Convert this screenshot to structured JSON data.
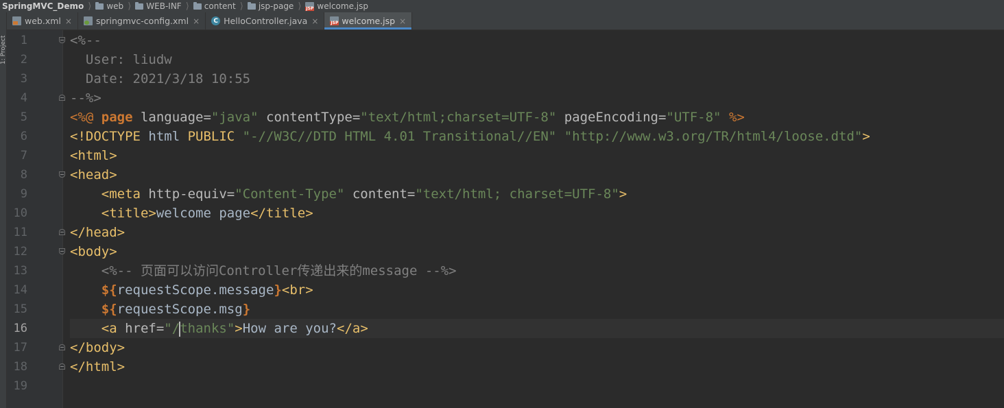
{
  "breadcrumb": [
    {
      "label": "SpringMVC_Demo",
      "icon": "none"
    },
    {
      "label": "web",
      "icon": "folder-icon"
    },
    {
      "label": "WEB-INF",
      "icon": "folder-icon"
    },
    {
      "label": "content",
      "icon": "folder-icon"
    },
    {
      "label": "jsp-page",
      "icon": "folder-icon"
    },
    {
      "label": "welcome.jsp",
      "icon": "jsp-file-icon"
    }
  ],
  "sidebar": {
    "label": "1: Project"
  },
  "tabs": [
    {
      "label": "web.xml",
      "icon": "xml-file-icon",
      "active": false
    },
    {
      "label": "springmvc-config.xml",
      "icon": "spring-xml-file-icon",
      "active": false
    },
    {
      "label": "HelloController.java",
      "icon": "java-class-icon",
      "active": false
    },
    {
      "label": "welcome.jsp",
      "icon": "jsp-file-icon",
      "active": true
    }
  ],
  "tab_close_glyph": "×",
  "editor": {
    "current_line": 16,
    "lines": [
      {
        "n": "1",
        "fold": "start",
        "tokens": [
          [
            "comment",
            "<%--"
          ]
        ]
      },
      {
        "n": "2",
        "tokens": [
          [
            "comment",
            "  User: liudw"
          ]
        ]
      },
      {
        "n": "3",
        "tokens": [
          [
            "comment",
            "  Date: 2021/3/18 10:55"
          ]
        ]
      },
      {
        "n": "4",
        "fold": "end",
        "tokens": [
          [
            "comment",
            "--%>"
          ]
        ]
      },
      {
        "n": "5",
        "tokens": [
          [
            "directive",
            "<%@ "
          ],
          [
            "keyword",
            "page"
          ],
          [
            "attr",
            " language="
          ],
          [
            "value",
            "\"java\""
          ],
          [
            "attr",
            " contentType="
          ],
          [
            "value",
            "\"text/html;charset=UTF-8\""
          ],
          [
            "attr",
            " pageEncoding="
          ],
          [
            "value",
            "\"UTF-8\""
          ],
          [
            "directive",
            " %>"
          ]
        ]
      },
      {
        "n": "6",
        "tokens": [
          [
            "tag",
            "<!DOCTYPE "
          ],
          [
            "plain",
            "html "
          ],
          [
            "tag",
            "PUBLIC "
          ],
          [
            "value",
            "\"-//W3C//DTD HTML 4.01 Transitional//EN\""
          ],
          [
            "plain",
            " "
          ],
          [
            "value",
            "\"http://www.w3.org/TR/html4/loose.dtd\""
          ],
          [
            "tag",
            ">"
          ]
        ]
      },
      {
        "n": "7",
        "tokens": [
          [
            "tag",
            "<html>"
          ]
        ]
      },
      {
        "n": "8",
        "fold": "start",
        "tokens": [
          [
            "tag",
            "<head>"
          ]
        ]
      },
      {
        "n": "9",
        "tokens": [
          [
            "plain",
            "    "
          ],
          [
            "tag",
            "<meta "
          ],
          [
            "attr",
            "http-equiv="
          ],
          [
            "value",
            "\"Content-Type\""
          ],
          [
            "attr",
            " content="
          ],
          [
            "value",
            "\"text/html; charset=UTF-8\""
          ],
          [
            "tag",
            ">"
          ]
        ]
      },
      {
        "n": "10",
        "tokens": [
          [
            "plain",
            "    "
          ],
          [
            "tag",
            "<title>"
          ],
          [
            "text",
            "welcome page"
          ],
          [
            "tag",
            "</title>"
          ]
        ]
      },
      {
        "n": "11",
        "fold": "end",
        "tokens": [
          [
            "tag",
            "</head>"
          ]
        ]
      },
      {
        "n": "12",
        "fold": "start",
        "tokens": [
          [
            "tag",
            "<body>"
          ]
        ]
      },
      {
        "n": "13",
        "tokens": [
          [
            "plain",
            "    "
          ],
          [
            "comment",
            "<%-- 页面可以访问Controller传递出来的message --%>"
          ]
        ]
      },
      {
        "n": "14",
        "tokens": [
          [
            "plain",
            "    "
          ],
          [
            "el",
            "${"
          ],
          [
            "elbody",
            "requestScope.message"
          ],
          [
            "el",
            "}"
          ],
          [
            "tag",
            "<br>"
          ]
        ]
      },
      {
        "n": "15",
        "tokens": [
          [
            "plain",
            "    "
          ],
          [
            "el",
            "${"
          ],
          [
            "elbody",
            "requestScope.msg"
          ],
          [
            "el",
            "}"
          ]
        ]
      },
      {
        "n": "16",
        "tokens": [
          [
            "plain",
            "    "
          ],
          [
            "tag",
            "<a "
          ],
          [
            "attr",
            "href="
          ],
          [
            "value",
            "\"/"
          ],
          [
            "caret",
            ""
          ],
          [
            "value",
            "thanks\""
          ],
          [
            "tag",
            ">"
          ],
          [
            "text",
            "How are you?"
          ],
          [
            "tag",
            "</a>"
          ]
        ]
      },
      {
        "n": "17",
        "fold": "end",
        "tokens": [
          [
            "tag",
            "</body>"
          ]
        ]
      },
      {
        "n": "18",
        "fold": "end",
        "tokens": [
          [
            "tag",
            "</html>"
          ]
        ]
      },
      {
        "n": "19",
        "tokens": []
      }
    ]
  }
}
